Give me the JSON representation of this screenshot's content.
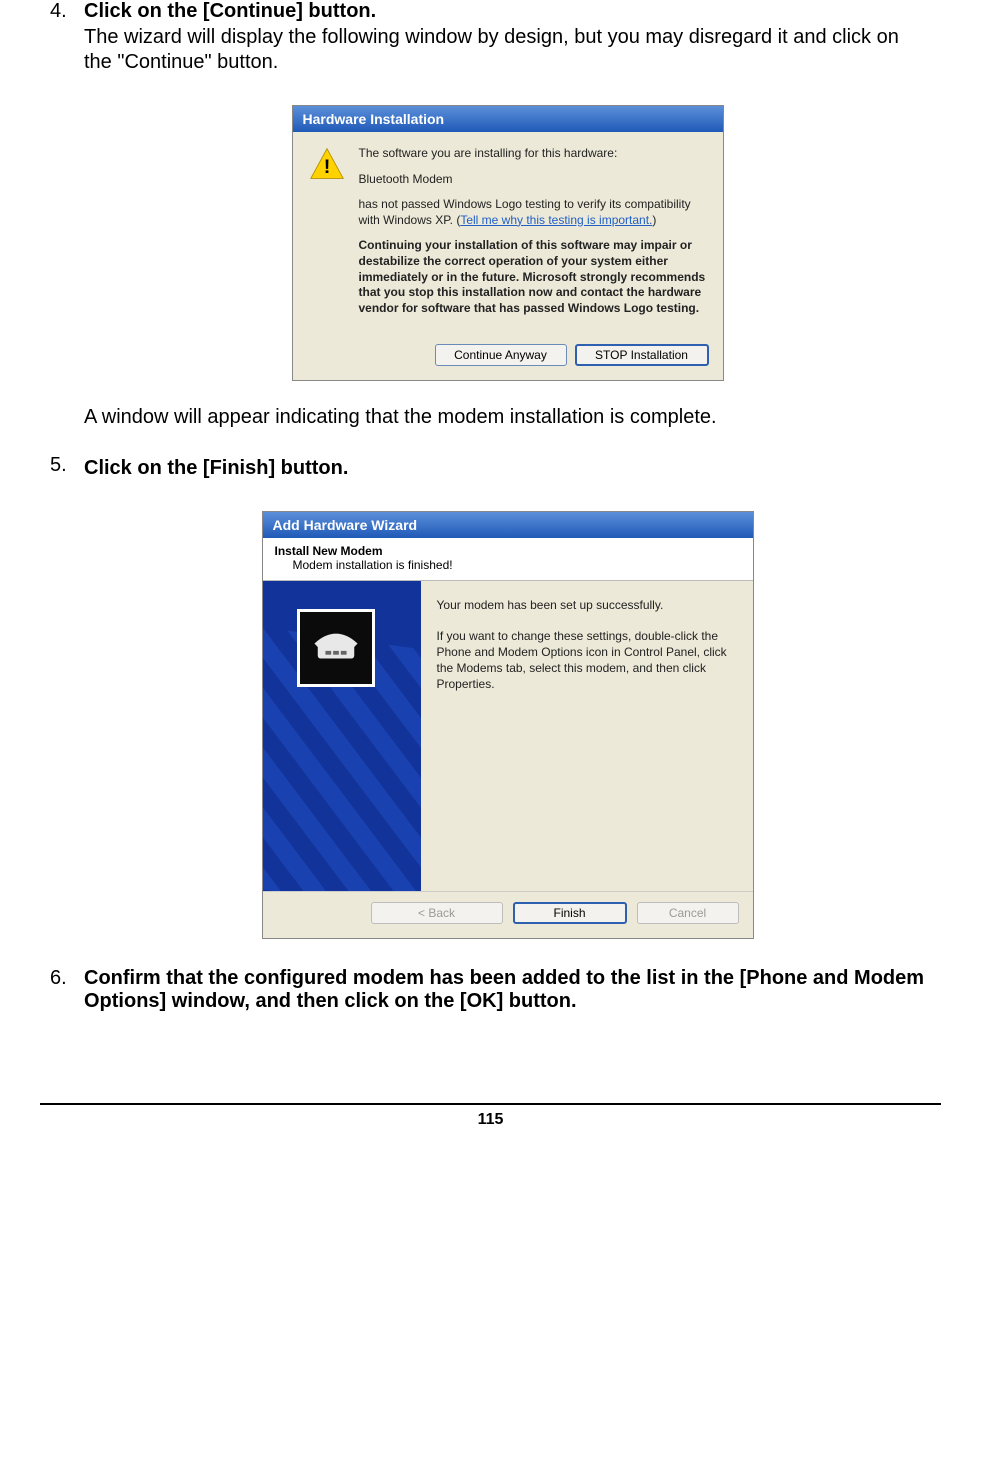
{
  "steps": {
    "s4": {
      "num": "4.",
      "title": "Click on the [Continue] button.",
      "desc": "The wizard will display the following window by design, but you may disregard it and click on the \"Continue\" button.",
      "after": "A window will appear indicating that the modem installation is complete."
    },
    "s5": {
      "num": "5.",
      "title": "Click on the [Finish] button."
    },
    "s6": {
      "num": "6.",
      "title": "Confirm that the configured modem has been added to the list in the [Phone and Modem Options] window, and then click on the [OK] button."
    }
  },
  "dialog1": {
    "title": "Hardware Installation",
    "line1": "The software you are installing for this hardware:",
    "device": "Bluetooth Modem",
    "line2a": "has not passed Windows Logo testing to verify its compatibility with Windows XP. (",
    "link": "Tell me why this testing is important.",
    "line2b": ")",
    "warn": "Continuing your installation of this software may impair or destabilize the correct operation of your system either immediately or in the future. Microsoft strongly recommends that you stop this installation now and contact the hardware vendor for software that has passed Windows Logo testing.",
    "btn_continue": "Continue Anyway",
    "btn_stop": "STOP Installation"
  },
  "dialog2": {
    "title": "Add Hardware Wizard",
    "sub_h": "Install New Modem",
    "sub_t": "Modem installation is finished!",
    "p1": "Your modem has been set up successfully.",
    "p2": "If you want to change these settings, double-click the Phone and Modem Options icon in Control Panel, click the Modems tab, select this modem, and then click Properties.",
    "btn_back": "< Back",
    "btn_finish": "Finish",
    "btn_cancel": "Cancel"
  },
  "page_number": "115"
}
